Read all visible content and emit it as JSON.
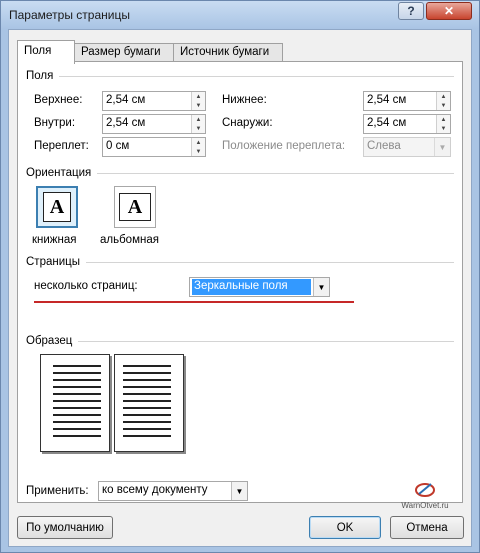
{
  "window": {
    "title": "Параметры страницы",
    "help_glyph": "?",
    "close_glyph": "✕"
  },
  "tabs": [
    {
      "label": "Поля",
      "active": true
    },
    {
      "label": "Размер бумаги",
      "active": false
    },
    {
      "label": "Источник бумаги",
      "active": false
    }
  ],
  "margins": {
    "section_title": "Поля",
    "top": {
      "label": "Верхнее:",
      "value": "2,54 см"
    },
    "bottom": {
      "label": "Нижнее:",
      "value": "2,54 см"
    },
    "inside": {
      "label": "Внутри:",
      "value": "2,54 см"
    },
    "outside": {
      "label": "Снаружи:",
      "value": "2,54 см"
    },
    "gutter": {
      "label": "Переплет:",
      "value": "0 см"
    },
    "gutter_position": {
      "label": "Положение переплета:",
      "value": "Слева",
      "disabled": true
    }
  },
  "orientation": {
    "section_title": "Ориентация",
    "portrait": {
      "label": "книжная",
      "glyph": "A",
      "selected": true
    },
    "landscape": {
      "label": "альбомная",
      "glyph": "A",
      "selected": false
    }
  },
  "pages": {
    "section_title": "Страницы",
    "multiple_label": "несколько страниц:",
    "multiple_value": "Зеркальные поля",
    "annotation_color": "#c62828"
  },
  "preview": {
    "section_title": "Образец"
  },
  "apply": {
    "label": "Применить:",
    "value": "ко всему документу"
  },
  "buttons": {
    "default": "По умолчанию",
    "ok": "OK",
    "cancel": "Отмена"
  },
  "watermark": {
    "text": "WarnOtvet.ru",
    "icon": "logo-icon"
  },
  "colors": {
    "accent": "#3c7fb1",
    "selection": "#3399ff"
  }
}
